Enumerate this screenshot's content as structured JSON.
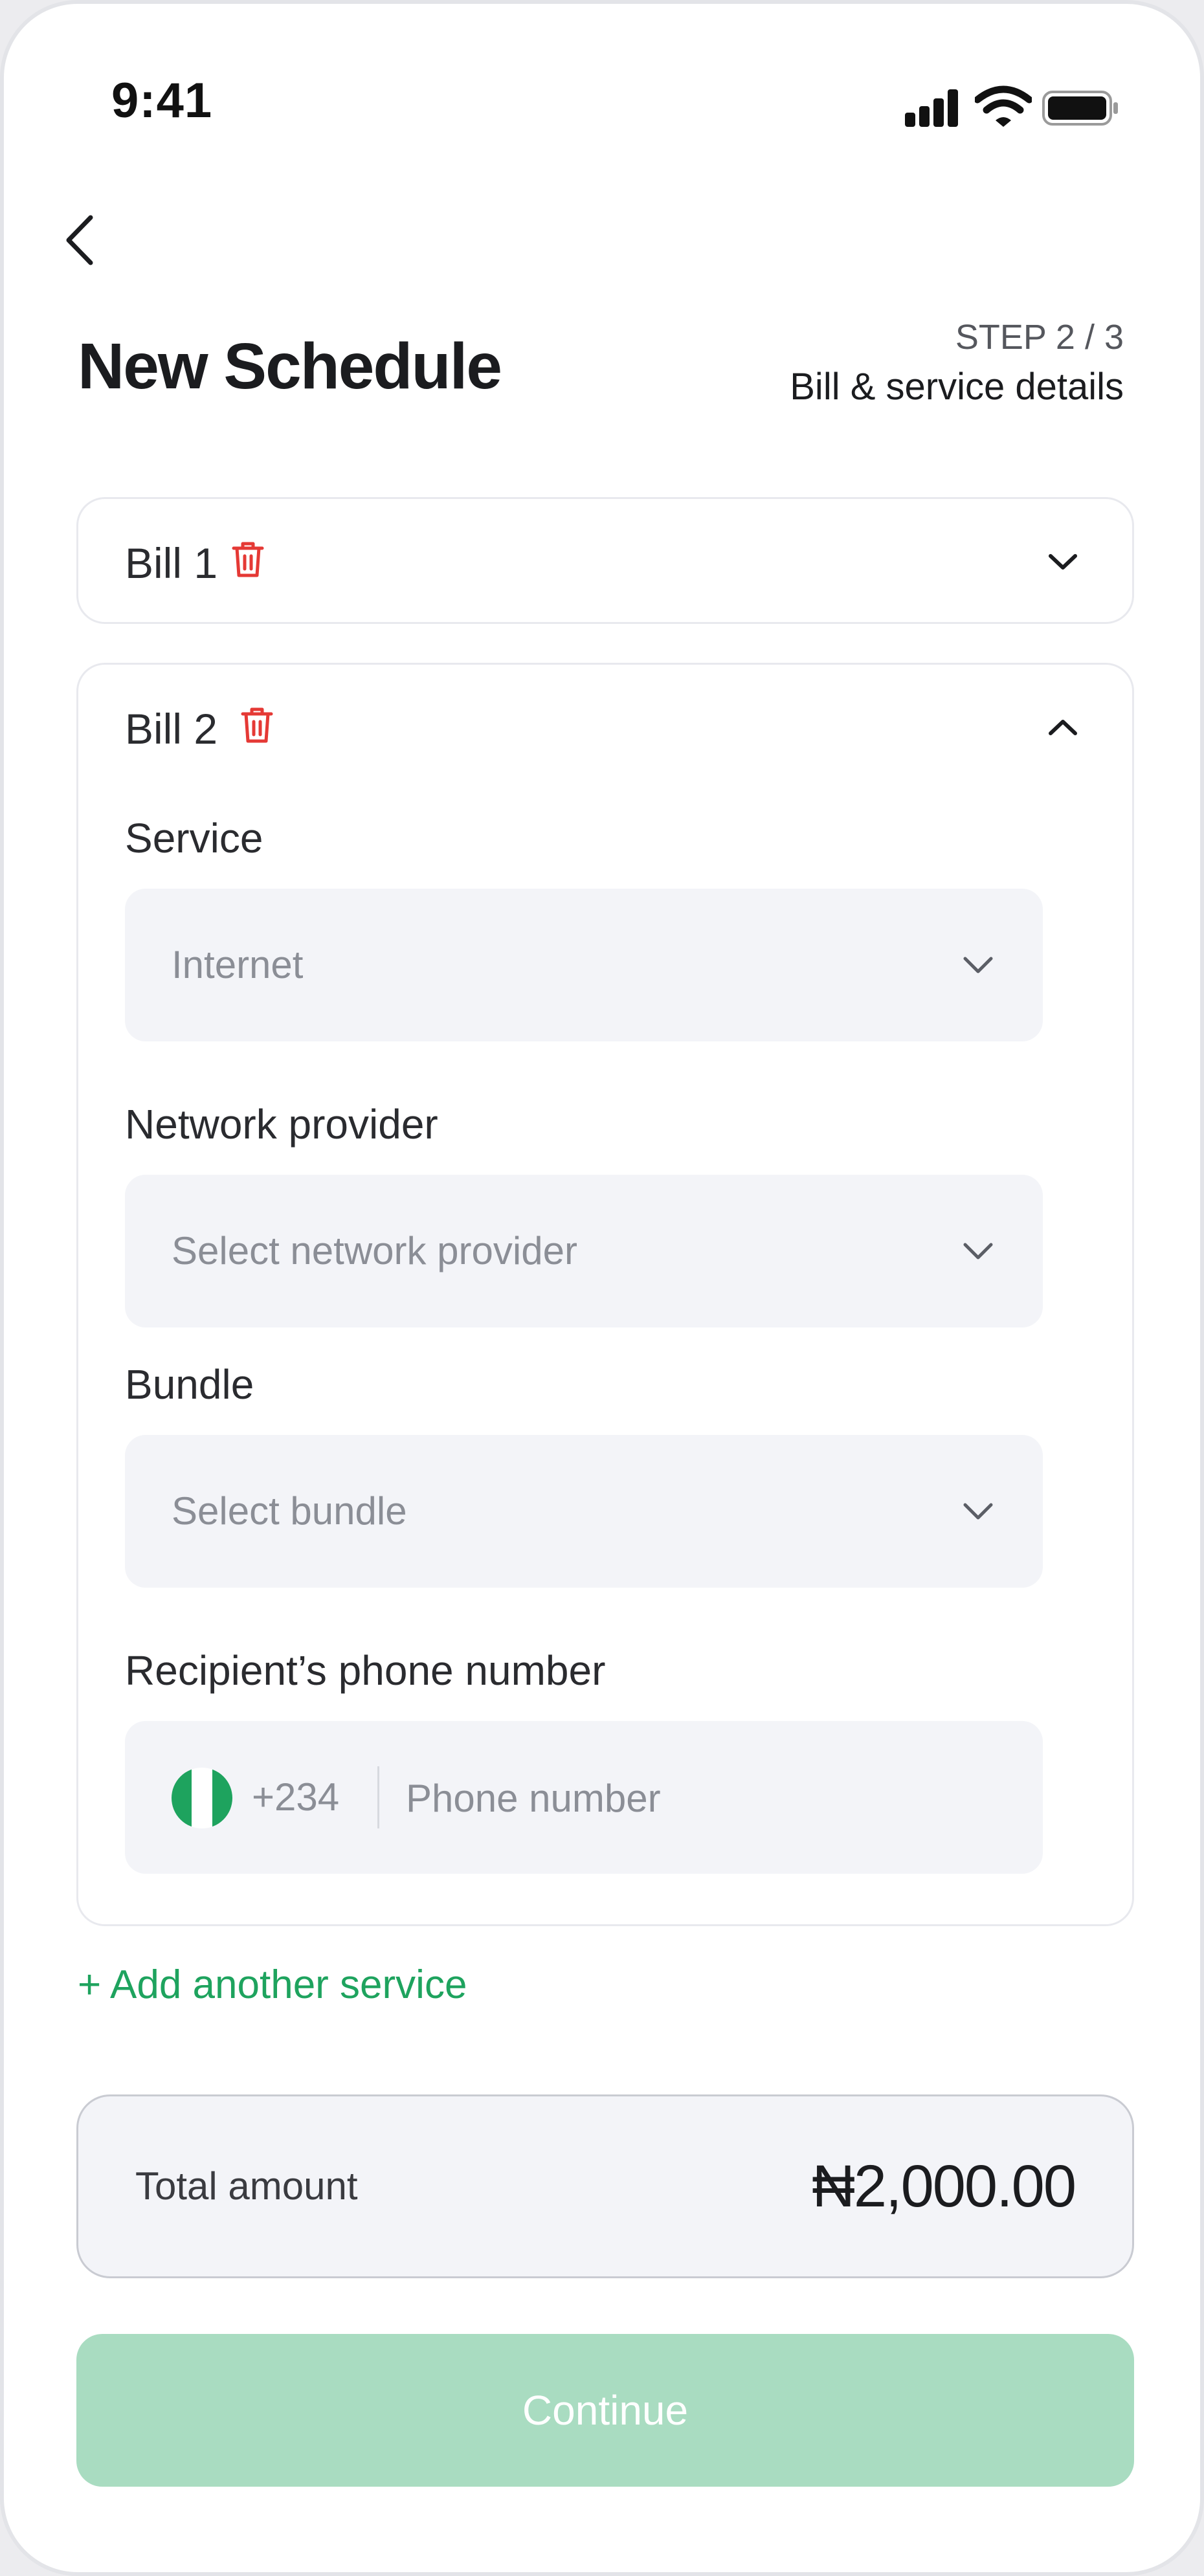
{
  "status_bar": {
    "time": "9:41"
  },
  "header": {
    "title": "New Schedule",
    "step": "STEP 2 / 3",
    "step_subtitle": "Bill & service details"
  },
  "bills": [
    {
      "label": "Bill 1",
      "expanded": false
    },
    {
      "label": "Bill 2",
      "expanded": true
    }
  ],
  "bill2_form": {
    "service": {
      "label": "Service",
      "value": "Internet"
    },
    "network_provider": {
      "label": "Network provider",
      "placeholder": "Select network provider"
    },
    "bundle": {
      "label": "Bundle",
      "placeholder": "Select bundle"
    },
    "phone": {
      "label": "Recipient’s phone number",
      "country_code": "+234",
      "placeholder": "Phone number",
      "country_flag": "nigeria-flag-icon"
    }
  },
  "add_service_label": "+ Add another service",
  "total": {
    "label": "Total amount",
    "value": "₦2,000.00"
  },
  "continue_label": "Continue",
  "colors": {
    "accent_green": "#1ea35e",
    "continue_disabled": "#a9dcc1",
    "delete_red": "#e53935",
    "field_bg": "#f3f4f8"
  }
}
